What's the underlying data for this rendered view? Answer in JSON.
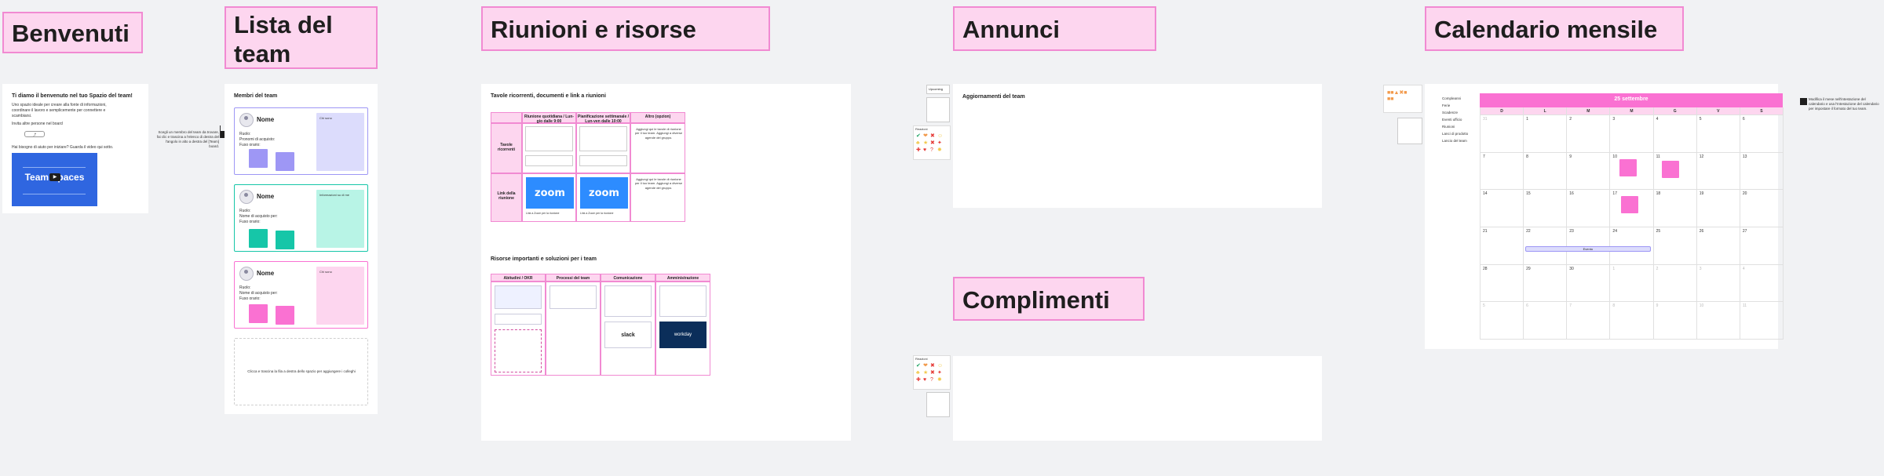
{
  "sections": {
    "benvenuti": "Benvenuti",
    "lista_team": "Lista del team",
    "riunioni": "Riunioni e risorse",
    "annunci": "Annunci",
    "calendario": "Calendario mensile",
    "complimenti": "Complimenti"
  },
  "welcome": {
    "heading": "Ti diamo il benvenuto nel tuo Spazio del team!",
    "body": "Uno spazio ideale per creare alla fonte di informazioni, coordinare il lavoro e semplicemente per connettere e scambiarsi.",
    "invite_label": "Invita altre persone nel board",
    "help_label": "Hai bisogno di aiuto per iniziare? Guarda il video qui sotto.",
    "video_title": "Team Spaces"
  },
  "team": {
    "heading": "Membri del team",
    "side_note": "Scegli un membro del team da trovare, fai clic e trascina a l'elenco di destra del l'angolo in alto a destra del [Team] board.",
    "members": [
      {
        "name": "Nome",
        "role_label": "Ruolo:",
        "pronoun_label": "Pronomi di acquisto:",
        "timezone_label": "Fuso orario:",
        "note": "Chi sono"
      },
      {
        "name": "Nome",
        "role_label": "Ruolo:",
        "pronoun_label": "Nome di acquisto per:",
        "timezone_label": "Fuso orario:",
        "note": "Informazioni su di me"
      },
      {
        "name": "Nome",
        "role_label": "Ruolo:",
        "pronoun_label": "Nome di acquisto per:",
        "timezone_label": "Fuso orario:",
        "note": "Chi sono"
      }
    ],
    "add_placeholder": "Clicca e trascina la fila a destra dello spazio per aggiungere i colleghi"
  },
  "meetings": {
    "heading": "Tavole ricorrenti, documenti e link a riunioni",
    "columns": [
      "Riunione quotidiana / Lun-gio dalle 9:00",
      "Pianificazione settimanale / Lun-ven dalle 10:00",
      "Altro (opzion)"
    ],
    "rows": [
      "Tavole ricorrenti",
      "Link della riunione"
    ],
    "other_note": "Aggiungi qui le tavole di riunione per il tuo team. Aggiungi a diverse agende del gruppo.",
    "zoom_label": "zoom",
    "zoom_caption": "Link a Zoom per la riunione"
  },
  "resources": {
    "heading": "Risorse importanti e soluzioni per i team",
    "columns": [
      "Abitudini / OKR",
      "Processi del team",
      "Comunicazione",
      "Amministrazione"
    ],
    "slack_label": "slack",
    "workday_label": "workday"
  },
  "announcements": {
    "heading": "Aggiornamenti del team",
    "sticky_label": "Upcoming",
    "reactions_label": "Reazioni"
  },
  "kudos": {
    "reactions_label": "Reazioni"
  },
  "calendar": {
    "month_label": "25 settembre",
    "weekdays": [
      "D",
      "L",
      "M",
      "M",
      "G",
      "V",
      "S"
    ],
    "weeks": [
      [
        "31",
        "1",
        "2",
        "3",
        "4",
        "5",
        "6"
      ],
      [
        "7",
        "8",
        "9",
        "10",
        "11",
        "12",
        "13"
      ],
      [
        "14",
        "15",
        "16",
        "17",
        "18",
        "19",
        "20"
      ],
      [
        "21",
        "22",
        "23",
        "24",
        "25",
        "26",
        "27"
      ],
      [
        "28",
        "29",
        "30",
        "1",
        "2",
        "3",
        "4"
      ],
      [
        "5",
        "6",
        "7",
        "8",
        "9",
        "10",
        "11"
      ]
    ],
    "legend": [
      "Compleanni",
      "Ferie",
      "Scadenze",
      "Eventi ufficio",
      "Riunioni",
      "Lanci di prodotto",
      "Lancio del team"
    ],
    "event_label": "Evento",
    "side_note": "Modifica il mese nell'intestazione del calendario e usa l'Intestazione del calendario per impostare il formato del tuo team."
  },
  "colors": {
    "pink": "#fdd6ef",
    "pink_border": "#f18ad2",
    "purple": "#9e97f5",
    "teal": "#16c6a8",
    "magenta": "#fa71d2"
  }
}
